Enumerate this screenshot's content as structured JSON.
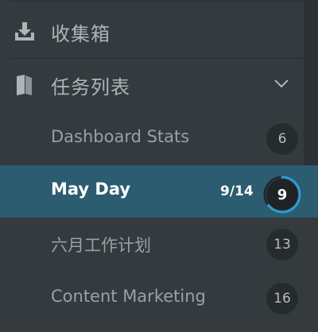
{
  "sidebar": {
    "inbox": {
      "label": "收集箱",
      "icon": "download-tray-icon"
    },
    "tasks": {
      "label": "任务列表",
      "icon": "book-icon",
      "toggle_icon": "chevron-down-icon",
      "items": [
        {
          "label": "Dashboard Stats",
          "count": "6",
          "active": false
        },
        {
          "label": "May Day",
          "count": "9",
          "progress_text": "9/14",
          "progress_fraction": 0.6429,
          "active": true
        },
        {
          "label": "六月工作计划",
          "count": "13",
          "active": false
        },
        {
          "label": "Content Marketing",
          "count": "16",
          "active": false
        }
      ]
    }
  },
  "colors": {
    "background": "#343a3d",
    "active_row": "#2c5c70",
    "progress_accent": "#2f9bd6",
    "badge_bg": "#262b2e"
  }
}
